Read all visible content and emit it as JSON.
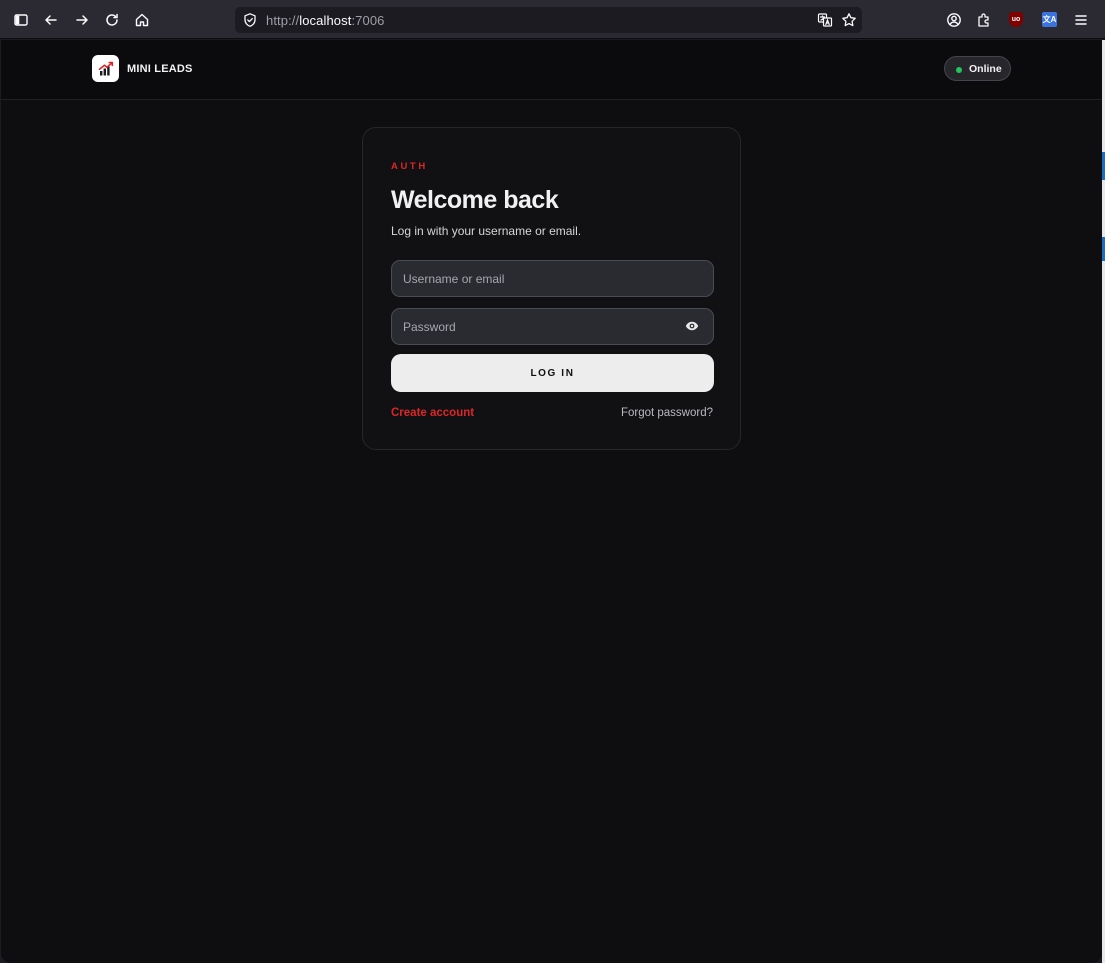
{
  "browser": {
    "url_prefix": "http://",
    "url_host": "localhost",
    "url_port": ":7006",
    "ublock_badge": "uo",
    "translate_badge": "文A",
    "icons": [
      "sidebar-icon",
      "back-icon",
      "forward-icon",
      "reload-icon",
      "home-icon",
      "shield-icon",
      "translate-icon",
      "star-icon",
      "account-icon",
      "extensions-icon",
      "ublock-icon",
      "translate-extension-icon",
      "menu-icon"
    ]
  },
  "header": {
    "brand_name": "MINI LEADS",
    "status_label": "Online",
    "status_color": "#22c55e"
  },
  "auth": {
    "eyebrow": "AUTH",
    "title": "Welcome back",
    "subtitle": "Log in with your username or email.",
    "username_placeholder": "Username or email",
    "password_placeholder": "Password",
    "login_label": "LOG IN",
    "create_account_label": "Create account",
    "forgot_password_label": "Forgot password?"
  },
  "colors": {
    "accent": "#dc2626",
    "background": "#0e0e10",
    "card": "#111114"
  }
}
